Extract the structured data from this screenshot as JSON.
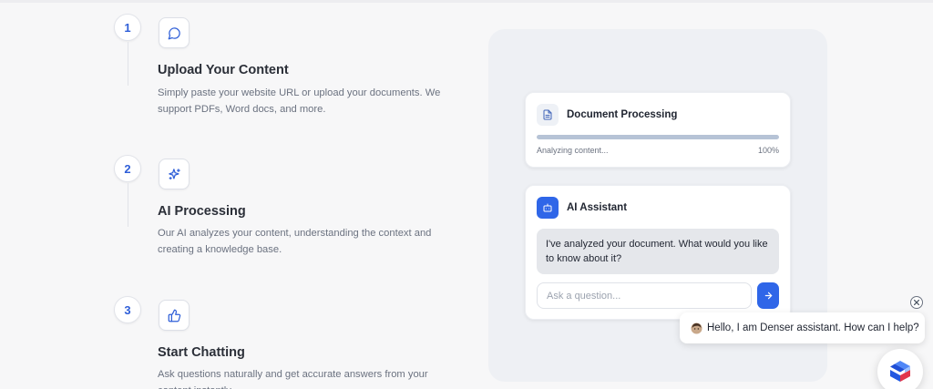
{
  "steps": [
    {
      "number": "1",
      "icon": "chat-bubble-icon",
      "title": "Upload Your Content",
      "description": "Simply paste your website URL or upload your documents. We support PDFs, Word docs, and more."
    },
    {
      "number": "2",
      "icon": "sparkles-icon",
      "title": "AI Processing",
      "description": "Our AI analyzes your content, understanding the context and creating a knowledge base."
    },
    {
      "number": "3",
      "icon": "thumbs-up-icon",
      "title": "Start Chatting",
      "description": "Ask questions naturally and get accurate answers from your content instantly."
    }
  ],
  "demo": {
    "processing": {
      "title": "Document Processing",
      "status": "Analyzing content...",
      "percent_label": "100%",
      "progress_fraction": 1.0
    },
    "assistant": {
      "title": "AI Assistant",
      "message": "I've analyzed your document. What would you like to know about it?",
      "input_placeholder": "Ask a question..."
    }
  },
  "chat_widget": {
    "greeting": "Hello, I am Denser assistant. How can I help?"
  },
  "colors": {
    "accent": "#2f66e8",
    "step_number": "#2f5fd8",
    "progress_fill": "#b6c3d6",
    "panel_bg": "#eef0f4",
    "bubble_bg": "#e5e7eb"
  }
}
